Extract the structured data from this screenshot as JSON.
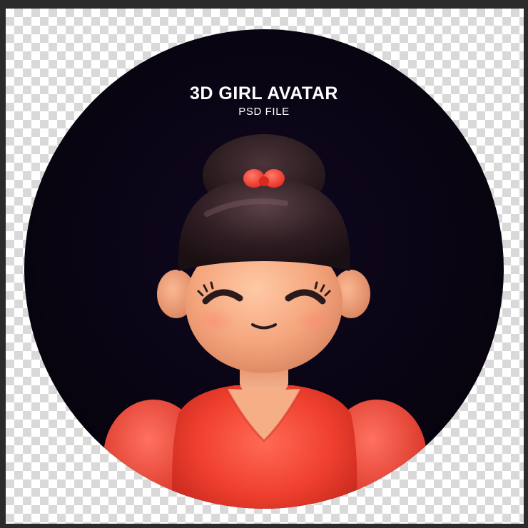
{
  "poster": {
    "title": "3D GIRL AVATAR",
    "subtitle": "PSD FILE"
  },
  "colors": {
    "background_circle": "#0b0515",
    "hair": "#2a1a1e",
    "skin": "#f2a27a",
    "shirt": "#f0402f",
    "hair_bow": "#ff3b2f",
    "transparency_check": "#d9d9d9"
  },
  "icons": {
    "transparency": "checkerboard-pattern",
    "figure": "girl-avatar-illustration"
  }
}
